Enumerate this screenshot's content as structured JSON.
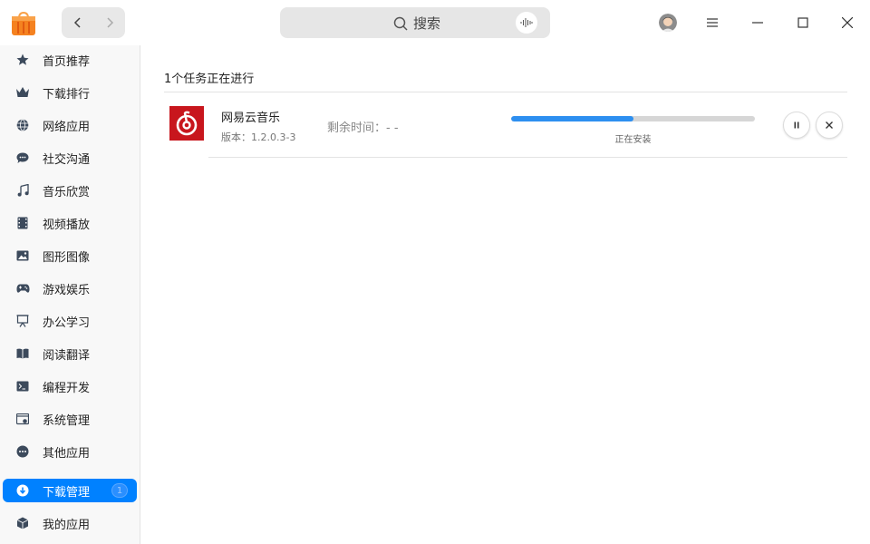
{
  "titlebar": {
    "search_placeholder": "搜索"
  },
  "sidebar": {
    "items": [
      {
        "label": "首页推荐",
        "icon": "star-icon"
      },
      {
        "label": "下载排行",
        "icon": "crown-icon"
      },
      {
        "label": "网络应用",
        "icon": "globe-icon"
      },
      {
        "label": "社交沟通",
        "icon": "chat-icon"
      },
      {
        "label": "音乐欣赏",
        "icon": "music-icon"
      },
      {
        "label": "视频播放",
        "icon": "film-icon"
      },
      {
        "label": "图形图像",
        "icon": "image-icon"
      },
      {
        "label": "游戏娱乐",
        "icon": "gamepad-icon"
      },
      {
        "label": "办公学习",
        "icon": "presentation-icon"
      },
      {
        "label": "阅读翻译",
        "icon": "book-icon"
      },
      {
        "label": "编程开发",
        "icon": "terminal-icon"
      },
      {
        "label": "系统管理",
        "icon": "system-icon"
      },
      {
        "label": "其他应用",
        "icon": "more-icon"
      }
    ],
    "download_manager": {
      "label": "下载管理",
      "badge": "1",
      "icon": "download-icon"
    },
    "my_apps": {
      "label": "我的应用",
      "icon": "box-icon"
    }
  },
  "main": {
    "heading": "1个任务正在进行",
    "task": {
      "name": "网易云音乐",
      "version": "版本：1.2.0.3-3",
      "remaining": "剩余时间：- -",
      "progress": 0.5,
      "status": "正在安装"
    }
  },
  "colors": {
    "accent": "#0081ff",
    "progress": "#2d8ff0",
    "app_icon_bg": "#c8161d"
  }
}
